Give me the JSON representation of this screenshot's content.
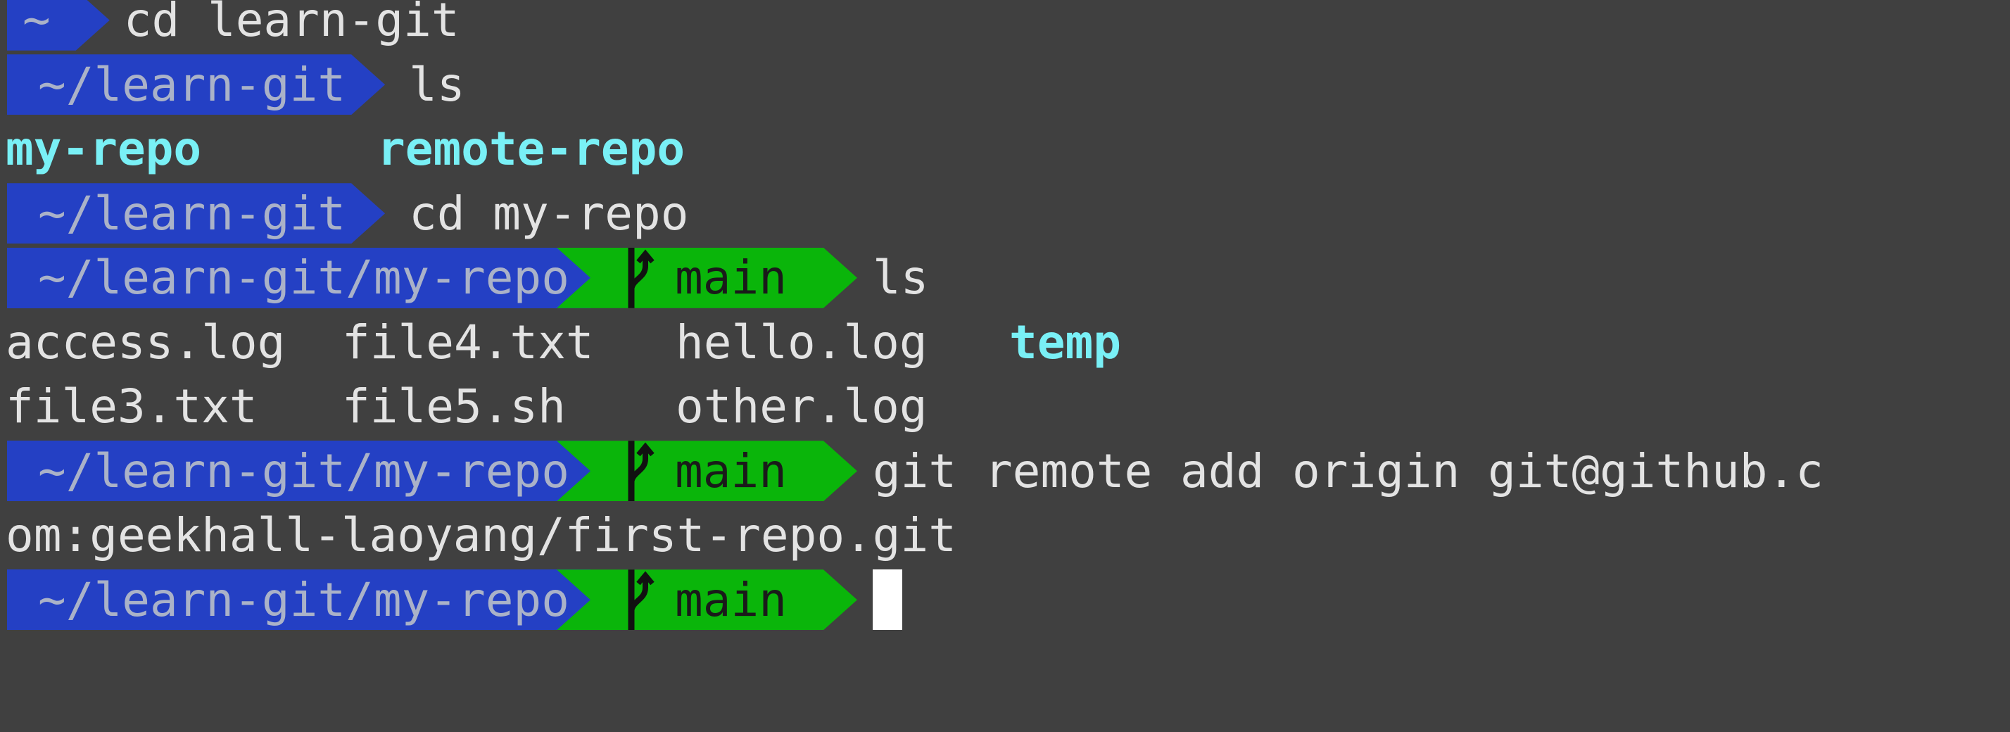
{
  "prompts": {
    "home": "~",
    "learn_git": "~/learn-git",
    "my_repo": "~/learn-git/my-repo",
    "branch": "main"
  },
  "commands": {
    "cmd1": "cd learn-git",
    "cmd2": "ls",
    "cmd3": "cd my-repo",
    "cmd4": "ls",
    "cmd5": "git remote add origin git@github.c",
    "cmd5_wrap": "om:geekhall-laoyang/first-repo.git"
  },
  "ls_learn_git": {
    "col1": "my-repo",
    "col2": "remote-repo"
  },
  "ls_my_repo": {
    "row1": [
      "access.log",
      "file4.txt",
      "hello.log",
      "temp"
    ],
    "row2": [
      "file3.txt",
      "file5.sh",
      "other.log"
    ]
  },
  "colors": {
    "background": "#404040",
    "dir_segment": "#2440c4",
    "git_segment": "#0ab50a",
    "directory_text": "#79f0f6"
  },
  "icons": {
    "branch": "git-branch-icon"
  }
}
